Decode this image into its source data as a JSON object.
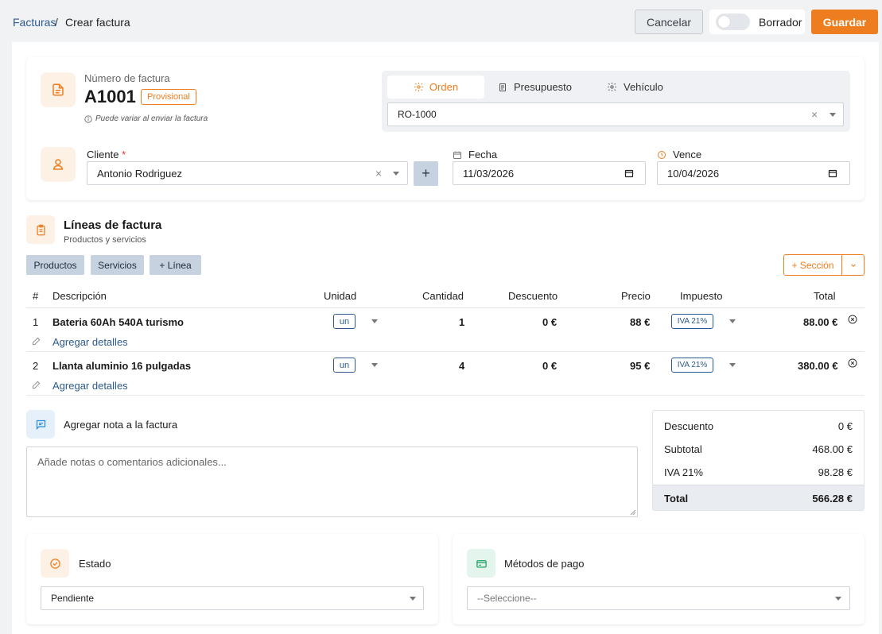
{
  "breadcrumb": {
    "parent": "Facturas",
    "separator": "/",
    "current": "Crear factura"
  },
  "header": {
    "cancel_label": "Cancelar",
    "draft_label": "Borrador",
    "save_label": "Guardar",
    "draft_on": false
  },
  "invoice": {
    "number_label": "Número de factura",
    "number": "A1001",
    "badge": "Provisional",
    "note": "Puede variar al enviar la factura"
  },
  "reference": {
    "tabs": [
      {
        "label": "Orden",
        "active": true
      },
      {
        "label": "Presupuesto",
        "active": false
      },
      {
        "label": "Vehículo",
        "active": false
      }
    ],
    "value": "RO-1000"
  },
  "customer": {
    "label": "Cliente",
    "required_mark": "*",
    "value": "Antonio Rodriguez",
    "add_label": "+"
  },
  "dates": {
    "fecha_label": "Fecha",
    "fecha_value": "11/03/2026",
    "vence_label": "Vence",
    "vence_value": "10/04/2026"
  },
  "lines_section": {
    "title": "Líneas de factura",
    "subtitle": "Productos y servicios",
    "buttons": {
      "productos": "Productos",
      "servicios": "Servicios",
      "linea": "+ Línea"
    },
    "seccion_label": "+ Sección"
  },
  "table": {
    "columns": [
      "#",
      "Descripción",
      "Unidad",
      "Cantidad",
      "Descuento",
      "Precio",
      "Impuesto",
      "Total"
    ],
    "rows": [
      {
        "num": "1",
        "desc": "Bateria 60Ah 540A turismo",
        "unit": "un",
        "qty": "1",
        "discount": "0 €",
        "price": "88 €",
        "tax": "IVA 21%",
        "total": "88.00 €",
        "details": "Agregar detalles"
      },
      {
        "num": "2",
        "desc": "Llanta aluminio 16 pulgadas",
        "unit": "un",
        "qty": "4",
        "discount": "0 €",
        "price": "95 €",
        "tax": "IVA 21%",
        "total": "380.00 €",
        "details": "Agregar detalles"
      }
    ]
  },
  "note": {
    "title": "Agregar nota a la factura",
    "placeholder": "Añade notas o comentarios adicionales..."
  },
  "summary": {
    "discount_label": "Descuento",
    "discount": "0 €",
    "subtotal_label": "Subtotal",
    "subtotal": "468.00 €",
    "iva_label": "IVA 21%",
    "iva": "98.28 €",
    "total_label": "Total",
    "total": "566.28 €"
  },
  "estado": {
    "title": "Estado",
    "value": "Pendiente"
  },
  "pago": {
    "title": "Métodos de pago",
    "placeholder": "--Seleccione--"
  },
  "colors": {
    "accent": "#ee7d1f",
    "link": "#2d5a8c",
    "pill": "#c6d2e0"
  }
}
